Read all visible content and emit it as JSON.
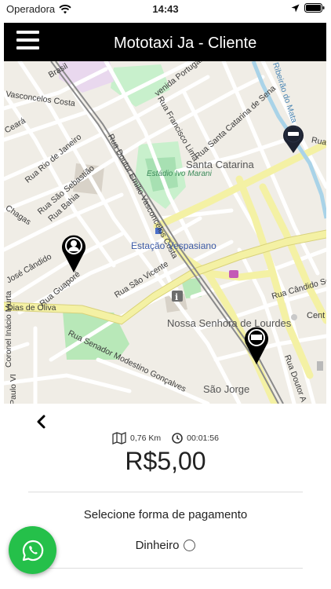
{
  "status_bar": {
    "carrier": "Operadora",
    "time": "14:43"
  },
  "header": {
    "title": "Mototaxi Ja - Cliente"
  },
  "map": {
    "labels": {
      "brasil": "Brasil",
      "vasconcelos_costa": "Vasconcelos Costa",
      "avenida_portugal": "venida Portugal",
      "francisco_lima": "Rua Francisco Lima",
      "santa_catarina_sena": "Rua Santa Catarina de Sena",
      "ribeirao": "Ribeirão do Mata",
      "rua_short": "Rua",
      "ceara": "Ceará",
      "rio_de_janeiro": "Rua Rio de Janeiro",
      "doutor_emilio": "Rua Doutor Emílio Vasconcelos Costa",
      "estadio": "Estádio Ivo Marani",
      "santa_catarina": "Santa Catarina",
      "sao_sebastiao": "Rua São Sebastião",
      "chagas": "Chagas",
      "rua_bahia": "Rua Bahia",
      "estacao": "Estação Vespasiano",
      "jose_candido": "José Cândido",
      "rua_guapore": "Rua Guaporé",
      "sao_vicente": "Rua São Vicente",
      "candido_soares": "Rua Cândido Soar",
      "dias_de_oliva": "Dias de Oliva",
      "cent": "Cent",
      "nossa_senhora": "Nossa Senhora de Lourdes",
      "coronel_inacio": "Coronel Inácio Murta",
      "senador_modestino": "Rua Senador Modestino Gonçalves",
      "doutor_a": "Rua Doutor A",
      "paulo_vi": "Paulo VI",
      "sao_jorge": "São Jorge"
    },
    "pins": [
      {
        "name": "driver",
        "icon": "motorcycle-helmet-icon"
      },
      {
        "name": "origin",
        "icon": "person-marker-icon"
      },
      {
        "name": "destination",
        "icon": "flag-marker-icon"
      }
    ]
  },
  "trip": {
    "distance": "0,76 Km",
    "duration": "00:01:56",
    "price": "R$5,00"
  },
  "payment": {
    "title": "Selecione forma de pagamento",
    "option_label": "Dinheiro"
  },
  "colors": {
    "header_bg": "#000000",
    "main_road": "#f4f1a4",
    "park": "#c8f0cc",
    "whatsapp": "#25c04a"
  }
}
